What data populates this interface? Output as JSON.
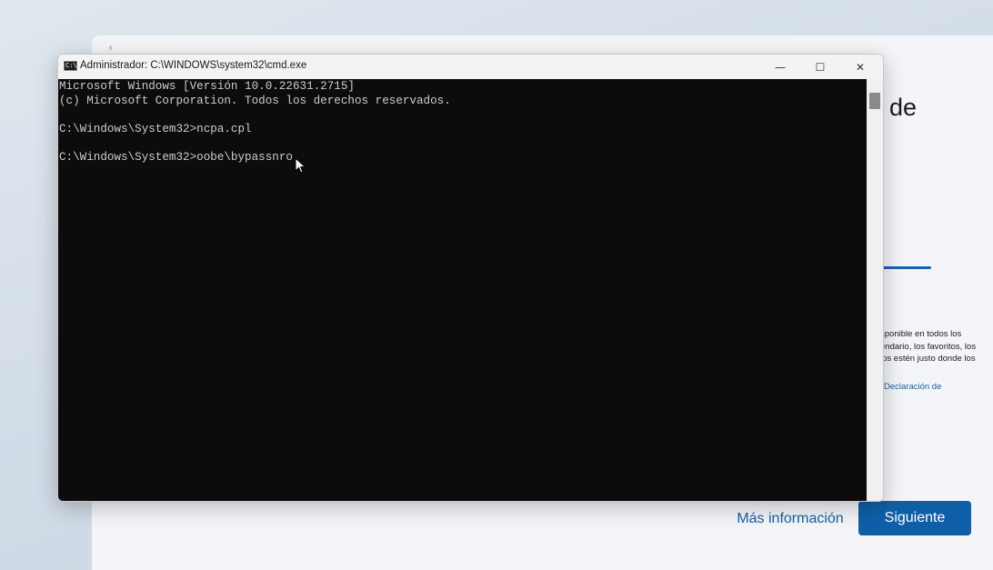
{
  "oobe": {
    "title_fragment": "de",
    "description_lines": [
      "sponible en todos los",
      "endario, los favoritos, los",
      "los estén justo donde los"
    ],
    "link_fragment": "Declaración de",
    "more_info_label": "Más información",
    "next_label": "Siguiente"
  },
  "cmd": {
    "title": "Administrador: C:\\WINDOWS\\system32\\cmd.exe",
    "icon_label": "C:\\",
    "lines": [
      "Microsoft Windows [Versión 10.0.22631.2715]",
      "(c) Microsoft Corporation. Todos los derechos reservados.",
      "",
      "C:\\Windows\\System32>ncpa.cpl",
      "",
      "C:\\Windows\\System32>oobe\\bypassnro"
    ],
    "minimize_glyph": "—",
    "maximize_glyph": "☐",
    "close_glyph": "✕"
  },
  "colors": {
    "console_bg": "#0c0c0c",
    "console_text": "#cccccc",
    "accent": "#0f5fa8"
  },
  "icons": [
    "cmd-app-icon",
    "minimize-icon",
    "maximize-icon",
    "close-icon",
    "mouse-pointer-icon"
  ]
}
